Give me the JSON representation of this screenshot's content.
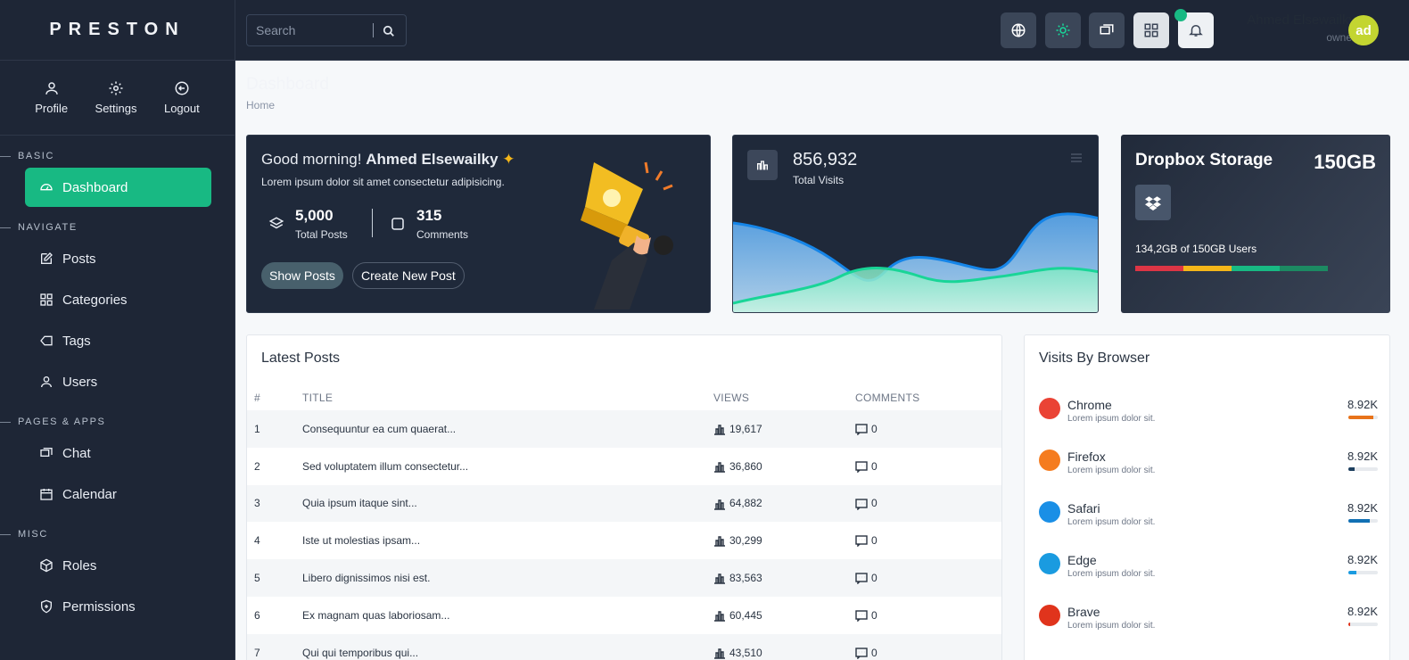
{
  "brand": "PRESTON",
  "quick": [
    {
      "label": "Profile",
      "icon": "user-icon"
    },
    {
      "label": "Settings",
      "icon": "gear-icon"
    },
    {
      "label": "Logout",
      "icon": "logout-icon"
    }
  ],
  "sections": {
    "basic": "BASIC",
    "navigate": "NAVIGATE",
    "pages": "PAGES & APPS",
    "misc": "MISC"
  },
  "nav": {
    "dashboard": "Dashboard",
    "posts": "Posts",
    "categories": "Categories",
    "tags": "Tags",
    "users": "Users",
    "chat": "Chat",
    "calendar": "Calendar",
    "roles": "Roles",
    "permissions": "Permissions"
  },
  "search": {
    "placeholder": "Search"
  },
  "user": {
    "name": "Ahmed Elsewailky",
    "role": "owner",
    "initials": "ad"
  },
  "page": {
    "title": "Dashboard",
    "breadcrumb": "Home"
  },
  "welcome": {
    "greeting": "Good morning!",
    "name": "Ahmed Elsewailky",
    "lead": "Lorem ipsum dolor sit amet consectetur adipisicing.",
    "posts_count": "5,000",
    "posts_label": "Total Posts",
    "comments_count": "315",
    "comments_label": "Comments",
    "show_posts": "Show Posts",
    "create_post": "Create New Post"
  },
  "visits": {
    "value": "856,932",
    "label": "Total Visits"
  },
  "dropbox": {
    "title": "Dropbox Storage",
    "size": "150GB",
    "used_label": "134,2GB of 150GB Users",
    "segments": [
      "#dc3545",
      "#f4b619",
      "#18b983",
      "#1c8a62"
    ]
  },
  "latest_posts": {
    "title": "Latest Posts",
    "headers": [
      "#",
      "TITLE",
      "VIEWS",
      "COMMENTS"
    ],
    "rows": [
      [
        "1",
        "Consequuntur ea cum quaerat...",
        "19,617",
        "0"
      ],
      [
        "2",
        "Sed voluptatem illum consectetur...",
        "36,860",
        "0"
      ],
      [
        "3",
        "Quia ipsum itaque sint...",
        "64,882",
        "0"
      ],
      [
        "4",
        "Iste ut molestias ipsam...",
        "30,299",
        "0"
      ],
      [
        "5",
        "Libero dignissimos nisi est.",
        "83,563",
        "0"
      ],
      [
        "6",
        "Ex magnam quas laboriosam...",
        "60,445",
        "0"
      ],
      [
        "7",
        "Qui qui temporibus qui...",
        "43,510",
        "0"
      ]
    ]
  },
  "browsers": {
    "title": "Visits By Browser",
    "items": [
      {
        "name": "Chrome",
        "sub": "Lorem ipsum dolor sit.",
        "value": "8.92K",
        "color": "#e8731a",
        "level": 0.85
      },
      {
        "name": "Firefox",
        "sub": "Lorem ipsum dolor sit.",
        "value": "8.92K",
        "color": "#1d3f5e",
        "level": 0.22
      },
      {
        "name": "Safari",
        "sub": "Lorem ipsum dolor sit.",
        "value": "8.92K",
        "color": "#1170b4",
        "level": 0.72
      },
      {
        "name": "Edge",
        "sub": "Lorem ipsum dolor sit.",
        "value": "8.92K",
        "color": "#1a9be0",
        "level": 0.28
      },
      {
        "name": "Brave",
        "sub": "Lorem ipsum dolor sit.",
        "value": "8.92K",
        "color": "#e0341c",
        "level": 0.06
      }
    ]
  }
}
